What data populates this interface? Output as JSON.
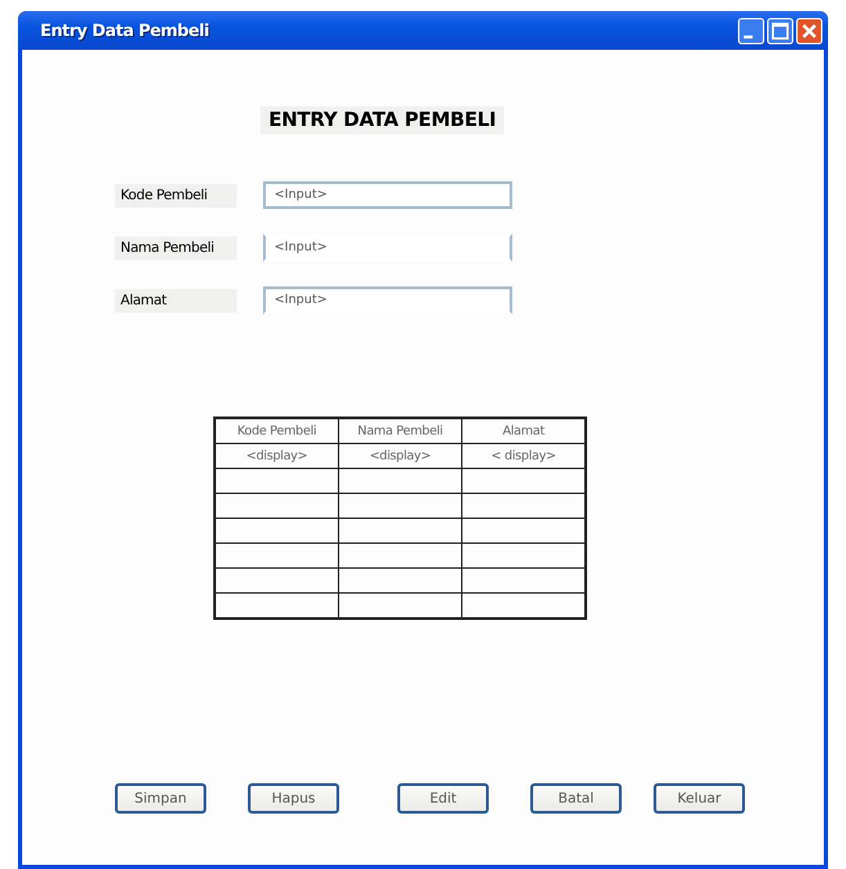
{
  "window": {
    "title": "Entry Data Pembeli"
  },
  "heading": "ENTRY DATA PEMBELI",
  "fields": [
    {
      "label": "Kode Pembeli",
      "placeholder": "<Input>",
      "kind": "box"
    },
    {
      "label": "Nama Pembeli",
      "placeholder": "<Input>",
      "kind": "sides"
    },
    {
      "label": "Alamat",
      "placeholder": "<Input>",
      "kind": "open"
    }
  ],
  "table": {
    "columns": [
      "Kode Pembeli",
      "Nama Pembeli",
      "Alamat"
    ],
    "rows": [
      [
        "<display>",
        "<display>",
        "< display>"
      ]
    ]
  },
  "buttons": [
    "Simpan",
    "Hapus",
    "Edit",
    "Batal",
    "Keluar"
  ]
}
